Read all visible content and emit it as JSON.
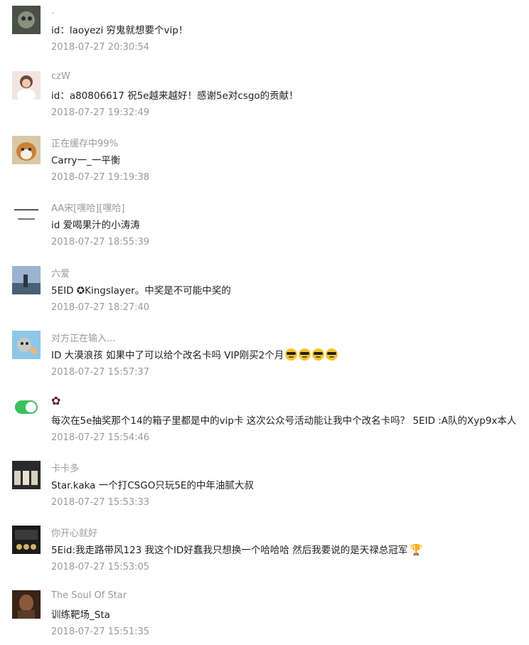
{
  "comments": [
    {
      "nickname": ".",
      "content": "id：laoyezi 穷鬼就想要个vip！",
      "time": "2018-07-27 20:30:54",
      "avatar_icon": "cat-photo-avatar"
    },
    {
      "nickname": "czW",
      "content": "id：a80806617 祝5e越来越好！感谢5e对csgo的贡献！",
      "time": "2018-07-27 19:32:49",
      "avatar_icon": "person-photo-avatar"
    },
    {
      "nickname": "正在缓存中99%",
      "content": "Carry一_一平衡",
      "time": "2018-07-27 19:19:38",
      "avatar_icon": "dog-photo-avatar"
    },
    {
      "nickname": "AA宋[嘿哈][嘿哈]",
      "content": "id 爱喝果汁的小涛涛",
      "time": "2018-07-27 18:55:39",
      "avatar_icon": "text-image-avatar"
    },
    {
      "nickname": "六爱",
      "content": "5EID ✪Kingslayer。中奖是不可能中奖的",
      "time": "2018-07-27 18:27:40",
      "avatar_icon": "landscape-photo-avatar"
    },
    {
      "nickname": "对方正在输入...",
      "content": "ID 大漠浪孩 如果中了可以给个改名卡吗 VIP刚买2个月",
      "emoji_count": 4,
      "time": "2018-07-27 15:57:37",
      "avatar_icon": "cartoon-avatar"
    },
    {
      "nickname": "✿",
      "content": "每次在5e抽奖那个14的箱子里都是中的vip卡 这次公众号活动能让我中个改名卡吗？ 5EID :A队的Xyp9x本人",
      "time": "2018-07-27 15:54:46",
      "avatar_icon": "toggle-switch-icon"
    },
    {
      "nickname": "卡卡多",
      "content": "Star.kaka 一个打CSGO只玩5E的中年油腻大叔",
      "time": "2018-07-27 15:53:33",
      "avatar_icon": "group-photo-avatar"
    },
    {
      "nickname": "你开心就好",
      "content": "5Eid:我走路带风123 我这个ID好蠢我只想换一个哈哈哈 然后我要说的是天禄总冠军",
      "time": "2018-07-27 15:53:05",
      "avatar_icon": "team-photo-avatar",
      "trailing_icon": "trophy-icon"
    },
    {
      "nickname": "The Soul Of Star",
      "content": "训练靶场_Sta",
      "time": "2018-07-27 15:51:35",
      "avatar_icon": "portrait-photo-avatar"
    }
  ]
}
